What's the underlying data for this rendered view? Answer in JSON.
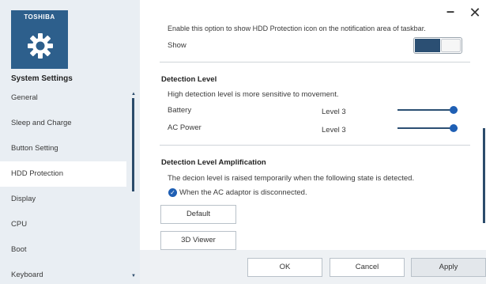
{
  "sidebar": {
    "brand": "TOSHIBA",
    "title": "System Settings",
    "items": [
      {
        "label": "General"
      },
      {
        "label": "Sleep and Charge"
      },
      {
        "label": "Button Setting"
      },
      {
        "label": "HDD Protection",
        "selected": true
      },
      {
        "label": "Display"
      },
      {
        "label": "CPU"
      },
      {
        "label": "Boot"
      },
      {
        "label": "Keyboard"
      }
    ]
  },
  "window_controls": {
    "minimize": "–",
    "close": "✕"
  },
  "notification": {
    "description": "Enable this option to show HDD Protection icon on the notification area of taskbar.",
    "show_label": "Show",
    "toggle_on": true
  },
  "detection_level": {
    "title": "Detection Level",
    "description": "High detection level is more sensitive to movement.",
    "rows": [
      {
        "label": "Battery",
        "value": "Level 3",
        "level_fraction": 1.0
      },
      {
        "label": "AC Power",
        "value": "Level 3",
        "level_fraction": 1.0
      }
    ]
  },
  "amplification": {
    "title": "Detection Level Amplification",
    "description": "The decion level is raised temporarily when the following state is detected.",
    "checkbox_label": "When the AC adaptor is disconnected.",
    "checked": true
  },
  "buttons": {
    "default": "Default",
    "viewer": "3D Viewer",
    "ok": "OK",
    "cancel": "Cancel",
    "apply": "Apply"
  },
  "colors": {
    "accent": "#1f5fb4",
    "logo_bg": "#2d5f8c",
    "sidebar_bg": "#e9eef3"
  }
}
